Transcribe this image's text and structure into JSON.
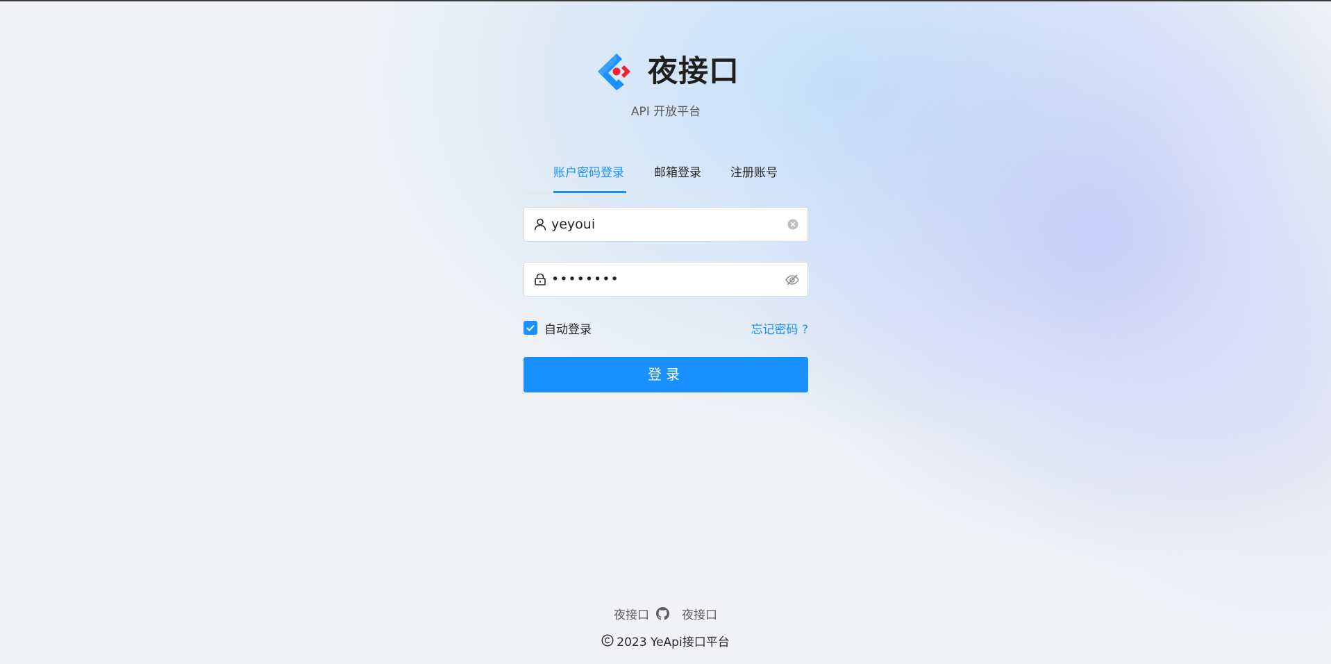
{
  "brand": {
    "title": "夜接口",
    "subtitle": "API 开放平台",
    "logo_icon": "diamond-logo-icon",
    "colors": {
      "blue": "#1890ff",
      "red": "#f5222d"
    }
  },
  "tabs": [
    {
      "label": "账户密码登录",
      "active": true
    },
    {
      "label": "邮箱登录",
      "active": false
    },
    {
      "label": "注册账号",
      "active": false
    }
  ],
  "form": {
    "username": {
      "value": "yeyoui",
      "prefix_icon": "user-icon",
      "suffix_icon": "clear-icon"
    },
    "password": {
      "value": "••••••••",
      "prefix_icon": "lock-icon",
      "suffix_icon": "eye-invisible-icon"
    },
    "auto_login": {
      "label": "自动登录",
      "checked": true
    },
    "forgot_password": "忘记密码 ?",
    "submit_label": "登录"
  },
  "footer": {
    "link_left": "夜接口",
    "link_right": "夜接口",
    "link_icon": "github-icon",
    "copyright": "2023 YeApi接口平台",
    "copyright_icon": "copyright-icon"
  },
  "theme": {
    "primary": "#1890ff",
    "text": "#262626",
    "muted": "#5c5c5c"
  }
}
